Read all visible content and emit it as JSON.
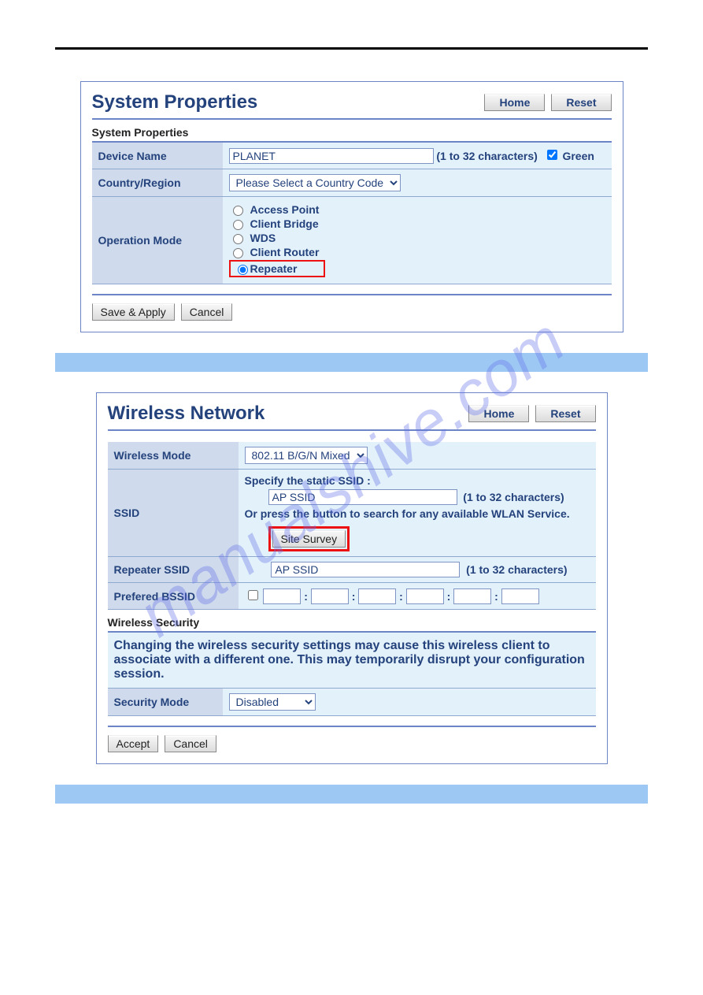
{
  "watermark": "manualshive.com",
  "panel1": {
    "title": "System Properties",
    "home_label": "Home",
    "reset_label": "Reset",
    "section_label": "System Properties",
    "device_name_label": "Device Name",
    "device_name_value": "PLANET",
    "device_name_hint": "(1 to 32 characters)",
    "green_label": "Green",
    "green_checked": true,
    "country_label": "Country/Region",
    "country_select": "Please Select a Country Code",
    "op_mode_label": "Operation Mode",
    "op_modes": {
      "ap": "Access Point",
      "bridge": "Client Bridge",
      "wds": "WDS",
      "router": "Client Router",
      "repeater": "Repeater"
    },
    "save_apply_label": "Save & Apply",
    "cancel_label": "Cancel"
  },
  "panel2": {
    "title": "Wireless Network",
    "home_label": "Home",
    "reset_label": "Reset",
    "wmode_label": "Wireless Mode",
    "wmode_select": "802.11 B/G/N Mixed",
    "ssid_label": "SSID",
    "specify_label": "Specify the static SSID  :",
    "ssid_value": "AP SSID",
    "ssid_hint": "(1 to 32 characters)",
    "or_press_label": "Or press the button to search for any available WLAN Service.",
    "site_survey_label": "Site Survey",
    "repeater_label": "Repeater SSID",
    "repeater_value": "AP SSID",
    "repeater_hint": "(1 to 32 characters)",
    "pref_bssid_label": "Prefered BSSID",
    "sec_section": "Wireless Security",
    "sec_note": "Changing the wireless security settings may cause this wireless client to associate with a different one. This may temporarily disrupt your configuration session.",
    "sec_mode_label": "Security Mode",
    "sec_mode_select": "Disabled",
    "accept_label": "Accept",
    "cancel_label": "Cancel"
  }
}
